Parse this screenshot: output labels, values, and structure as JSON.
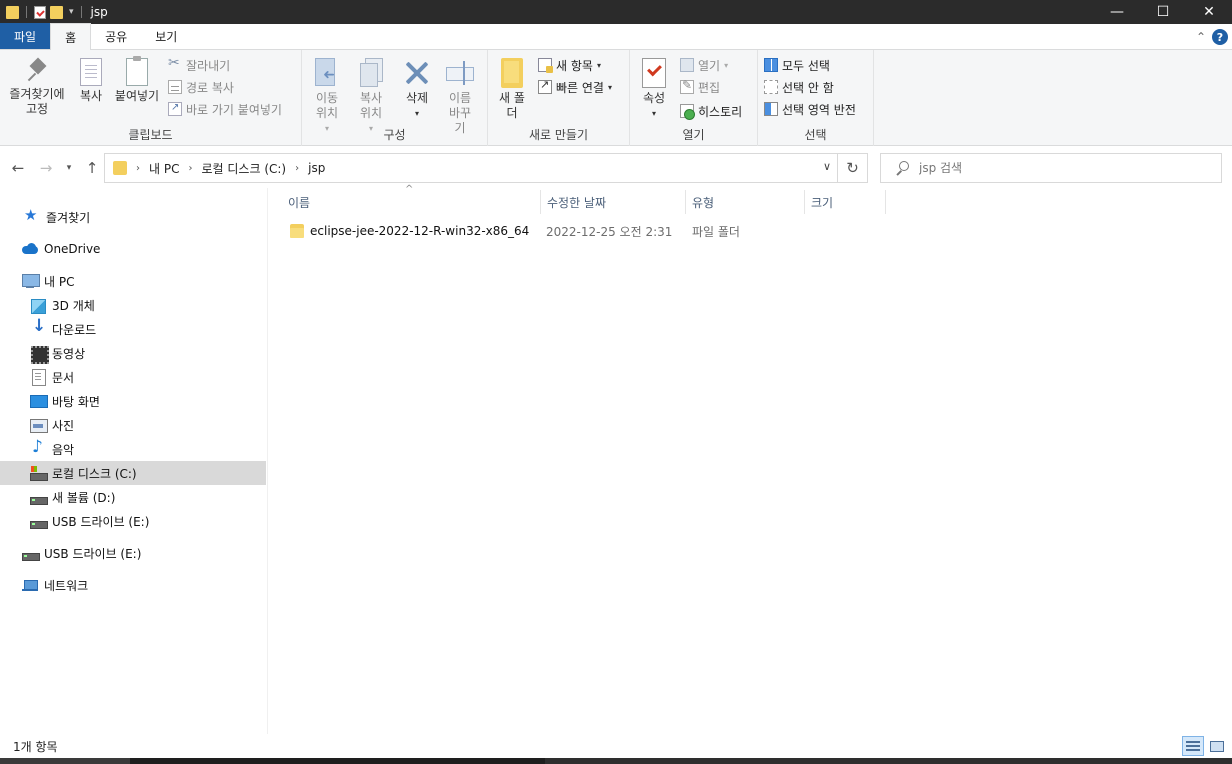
{
  "window": {
    "title": "jsp",
    "controls": {
      "minimize": "—",
      "maximize": "☐",
      "close": "✕"
    }
  },
  "ribbon_tabs": [
    "파일",
    "홈",
    "공유",
    "보기"
  ],
  "ribbon": {
    "clipboard": {
      "pin_label": "즐겨찾기에 고정",
      "copy_label": "복사",
      "paste_label": "붙여넣기",
      "cut_label": "잘라내기",
      "copy_path_label": "경로 복사",
      "paste_shortcut_label": "바로 가기 붙여넣기",
      "group_label": "클립보드"
    },
    "organize": {
      "move_to_label": "이동 위치",
      "copy_to_label": "복사 위치",
      "delete_label": "삭제",
      "rename_label": "이름 바꾸기",
      "group_label": "구성"
    },
    "new": {
      "new_folder_label": "새 폴더",
      "new_item_label": "새 항목",
      "easy_access_label": "빠른 연결",
      "group_label": "새로 만들기"
    },
    "open": {
      "properties_label": "속성",
      "open_label": "열기",
      "edit_label": "편집",
      "history_label": "히스토리",
      "group_label": "열기"
    },
    "select": {
      "select_all_label": "모두 선택",
      "select_none_label": "선택 안 함",
      "invert_label": "선택 영역 반전",
      "group_label": "선택"
    }
  },
  "address": {
    "crumbs": [
      "내 PC",
      "로컬 디스크 (C:)",
      "jsp"
    ]
  },
  "search": {
    "placeholder": "jsp 검색"
  },
  "nav_pane": {
    "items": [
      {
        "label": "즐겨찾기",
        "icon": "star-icon"
      },
      {
        "label": "OneDrive",
        "icon": "cloud-icon"
      },
      {
        "label": "내 PC",
        "icon": "computer-icon"
      },
      {
        "label": "3D 개체",
        "icon": "cube-icon"
      },
      {
        "label": "다운로드",
        "icon": "download-icon"
      },
      {
        "label": "동영상",
        "icon": "video-icon"
      },
      {
        "label": "문서",
        "icon": "document-icon"
      },
      {
        "label": "바탕 화면",
        "icon": "desktop-icon"
      },
      {
        "label": "사진",
        "icon": "picture-icon"
      },
      {
        "label": "음악",
        "icon": "music-icon"
      },
      {
        "label": "로컬 디스크 (C:)",
        "icon": "windows-drive-icon"
      },
      {
        "label": "새 볼륨 (D:)",
        "icon": "drive-icon"
      },
      {
        "label": "USB 드라이브 (E:)",
        "icon": "usb-drive-icon"
      },
      {
        "label": "USB 드라이브 (E:)",
        "icon": "usb-drive-icon"
      },
      {
        "label": "네트워크",
        "icon": "network-icon"
      }
    ]
  },
  "file_list": {
    "columns": [
      "이름",
      "수정한 날짜",
      "유형",
      "크기"
    ],
    "sort_indicator": "^",
    "rows": [
      {
        "name": "eclipse-jee-2022-12-R-win32-x86_64",
        "modified": "2022-12-25 오전 2:31",
        "type": "파일 폴더",
        "size": ""
      }
    ]
  },
  "status": {
    "item_count": "1개 항목"
  }
}
